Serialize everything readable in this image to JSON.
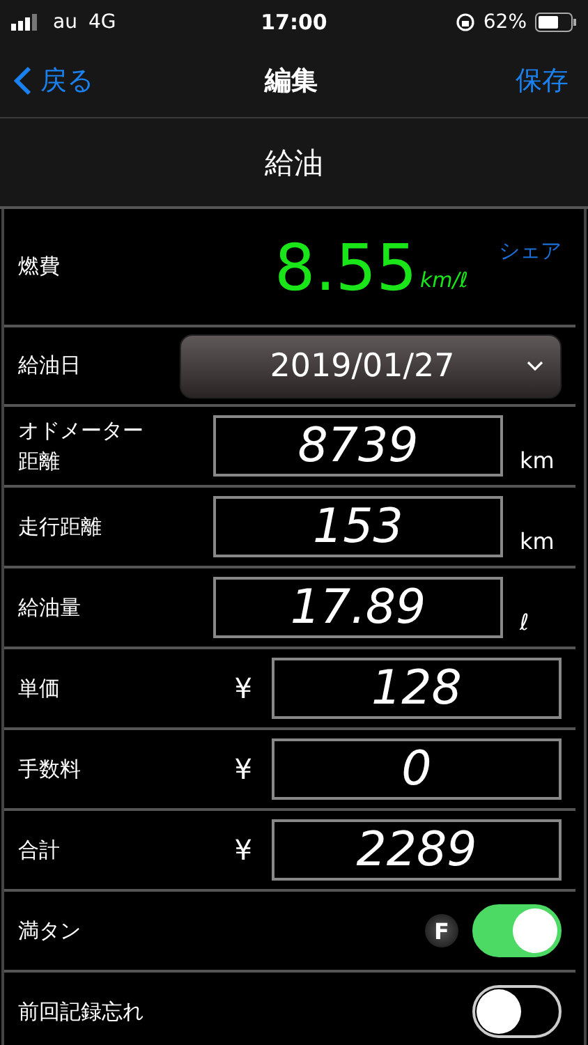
{
  "status_bar": {
    "carrier": "au",
    "network": "4G",
    "time": "17:00",
    "battery": "62%"
  },
  "nav": {
    "back": "戻る",
    "title": "編集",
    "action": "保存"
  },
  "section_title": "給油",
  "rows": [
    {
      "kind": "economy",
      "label": "燃費",
      "value": "8.55",
      "unit": "km/ℓ",
      "link": "シェア"
    },
    {
      "kind": "date",
      "label": "給油日",
      "value": "2019/01/27"
    },
    {
      "kind": "input",
      "label": "オドメーター距離",
      "value": "8739",
      "unit": "km"
    },
    {
      "kind": "input",
      "label": "走行距離",
      "value": "153",
      "unit": "km"
    },
    {
      "kind": "input",
      "label": "給油量",
      "value": "17.89",
      "unit": "ℓ"
    },
    {
      "kind": "price",
      "label": "単価",
      "currency": "¥",
      "value": "128"
    },
    {
      "kind": "price",
      "label": "手数料",
      "currency": "¥",
      "value": "0"
    },
    {
      "kind": "price",
      "label": "合計",
      "currency": "¥",
      "value": "2289"
    },
    {
      "kind": "toggle",
      "label": "満タン",
      "badge": "F",
      "on": true
    },
    {
      "kind": "toggle",
      "label": "前回記録忘れ",
      "on": false
    }
  ]
}
